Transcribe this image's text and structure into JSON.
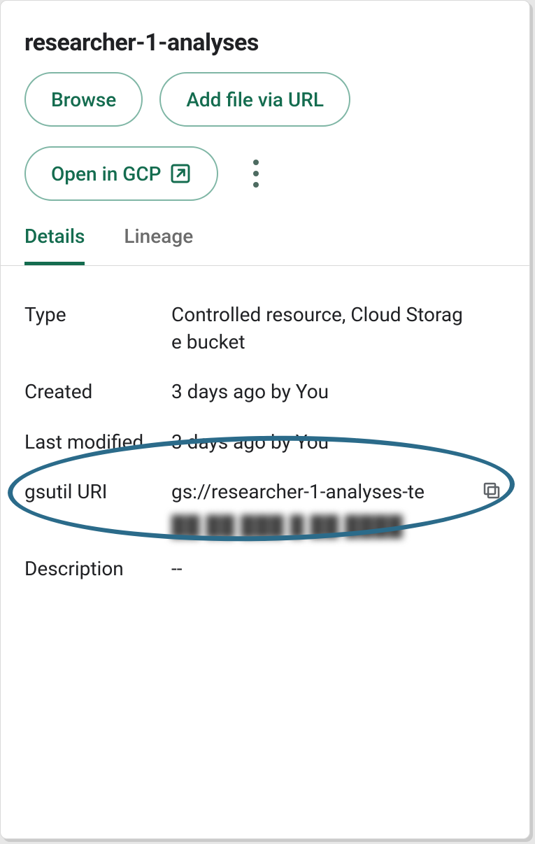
{
  "title": "researcher-1-analyses",
  "actions": {
    "browse": "Browse",
    "add_url": "Add file via URL",
    "open_gcp": "Open in GCP"
  },
  "tabs": {
    "details": "Details",
    "lineage": "Lineage",
    "active": "details"
  },
  "details": {
    "type": {
      "label": "Type",
      "value": "Controlled resource, Cloud Storage bucket"
    },
    "created": {
      "label": "Created",
      "value": "3 days ago by You"
    },
    "modified": {
      "label": "Last modified",
      "value": "3 days ago by You"
    },
    "gsutil": {
      "label": "gsutil URI",
      "value": "gs://researcher-1-analyses-te"
    },
    "description": {
      "label": "Description",
      "value": "--"
    }
  }
}
